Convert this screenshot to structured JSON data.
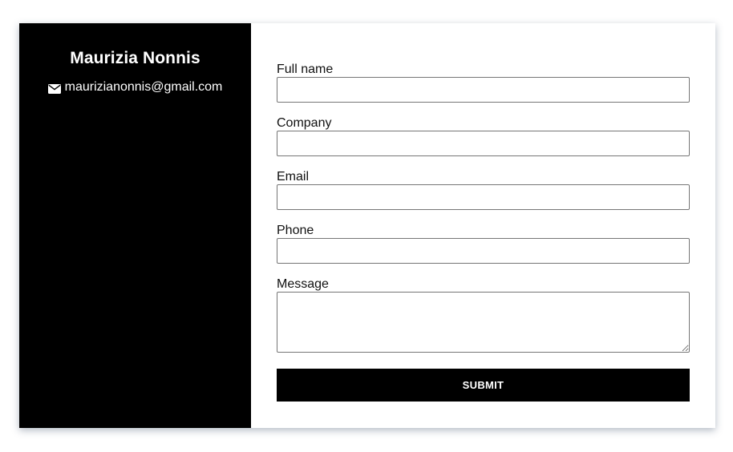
{
  "sidebar": {
    "name": "Maurizia Nonnis",
    "email": "maurizianonnis@gmail.com",
    "email_icon": "envelope-icon"
  },
  "form": {
    "fields": [
      {
        "label": "Full name",
        "value": "",
        "placeholder": ""
      },
      {
        "label": "Company",
        "value": "",
        "placeholder": ""
      },
      {
        "label": "Email",
        "value": "",
        "placeholder": ""
      },
      {
        "label": "Phone",
        "value": "",
        "placeholder": ""
      }
    ],
    "message": {
      "label": "Message",
      "value": "",
      "placeholder": ""
    },
    "submit_label": "SUBMIT"
  },
  "colors": {
    "sidebar_bg": "#000000",
    "sidebar_text": "#ffffff",
    "button_bg": "#000000",
    "button_text": "#ffffff",
    "input_border": "#767676"
  }
}
